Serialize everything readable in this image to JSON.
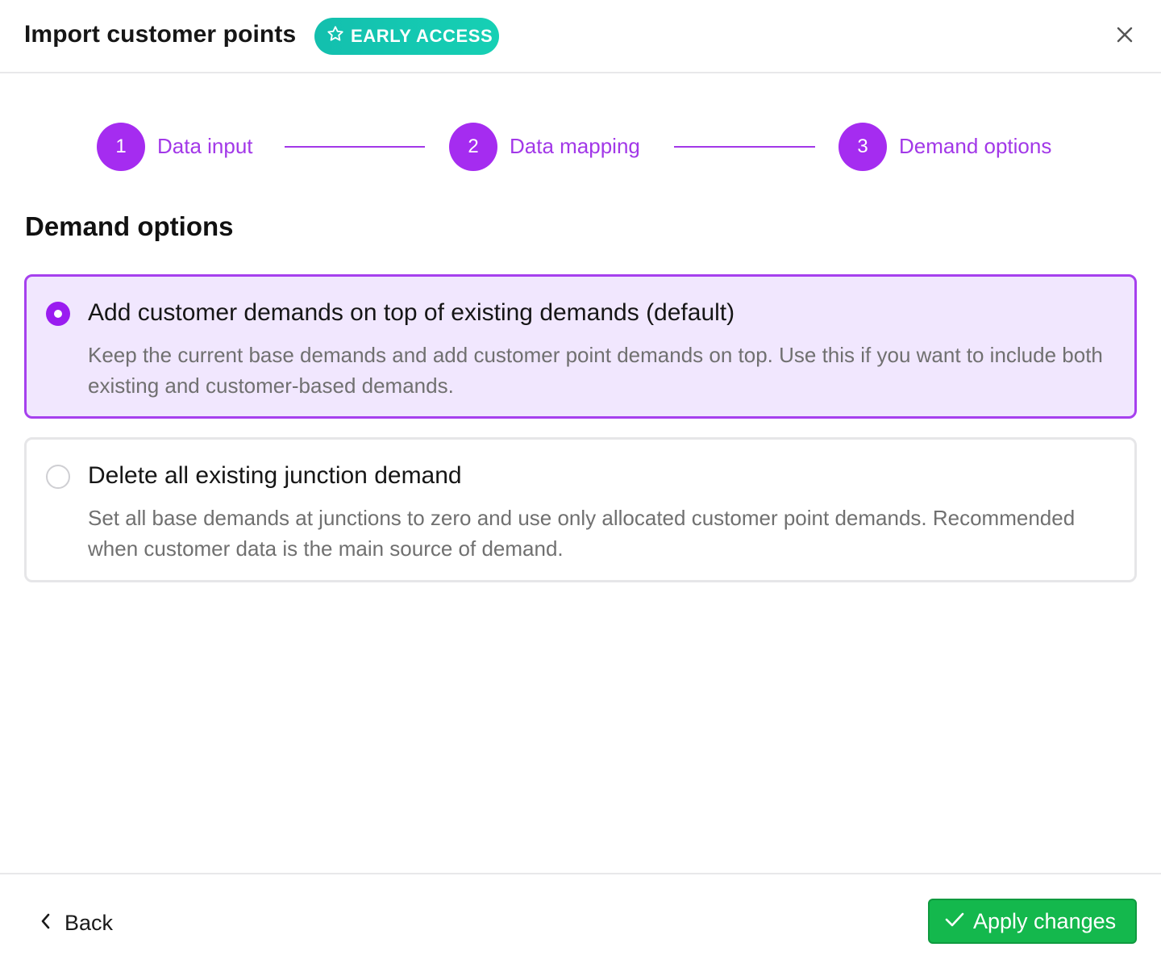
{
  "header": {
    "title": "Import customer points",
    "badge": "EARLY ACCESS"
  },
  "stepper": {
    "steps": [
      {
        "number": "1",
        "label": "Data input"
      },
      {
        "number": "2",
        "label": "Data mapping"
      },
      {
        "number": "3",
        "label": "Demand options"
      }
    ],
    "active_step": 3
  },
  "main": {
    "section_title": "Demand options",
    "options": [
      {
        "title": "Add customer demands on top of existing demands (default)",
        "description": "Keep the current base demands and add customer point demands on top. Use this if you want to include both existing and customer-based demands.",
        "selected": true
      },
      {
        "title": "Delete all existing junction demand",
        "description": "Set all base demands at junctions to zero and use only allocated customer point demands. Recommended when customer data is the main source of demand.",
        "selected": false
      }
    ]
  },
  "footer": {
    "back_label": "Back",
    "apply_label": "Apply changes"
  },
  "colors": {
    "accent": "#a52cf0",
    "badge": "#13bfae",
    "apply": "#14b84d"
  },
  "icons": {
    "badge": "star-icon",
    "close": "close-icon",
    "back": "chevron-left-icon",
    "apply": "check-icon"
  }
}
